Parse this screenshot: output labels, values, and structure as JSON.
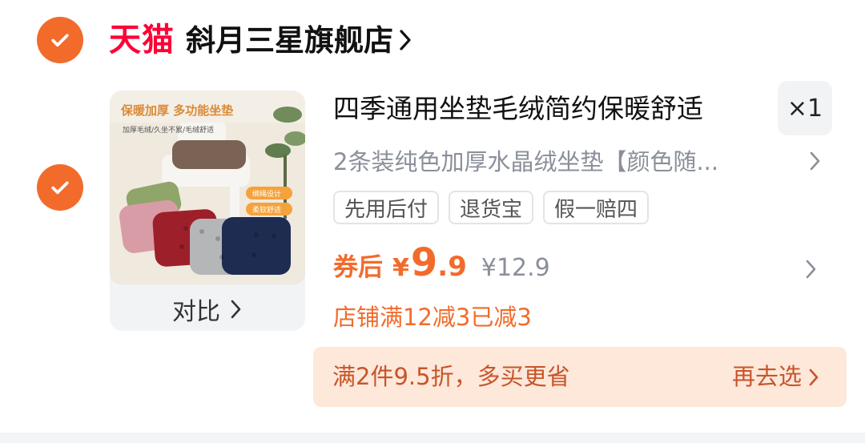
{
  "shop": {
    "platform": "天猫",
    "name": "斜月三星旗舰店"
  },
  "product": {
    "title": "四季通用坐垫毛绒简约保暖舒适",
    "quantity": "×1",
    "sku": "2条装纯色加厚水晶绒坐垫【颜色随...",
    "compare_label": "对比",
    "image_text": {
      "headline": "保暖加厚 多功能坐垫",
      "sub": "加厚毛绒/久坐不累/毛绒舒适",
      "badge1": "绑绳设计",
      "badge2": "柔软舒适"
    },
    "tags": [
      "先用后付",
      "退货宝",
      "假一赔四"
    ],
    "price": {
      "label": "券后",
      "currency": "¥",
      "integer": "9",
      "decimal": ".9",
      "original": "¥12.9"
    },
    "discount_note": "店铺满12减3已减3"
  },
  "promo": {
    "text": "满2件9.5折，多买更省",
    "action": "再去选"
  },
  "colors": {
    "accent": "#f26b2b",
    "tmall_red": "#ff0036",
    "promo_bg": "#fde8da",
    "muted_text": "#8a8f99"
  },
  "icons": {
    "check": "check-icon",
    "chevron": "chevron-right-icon"
  }
}
